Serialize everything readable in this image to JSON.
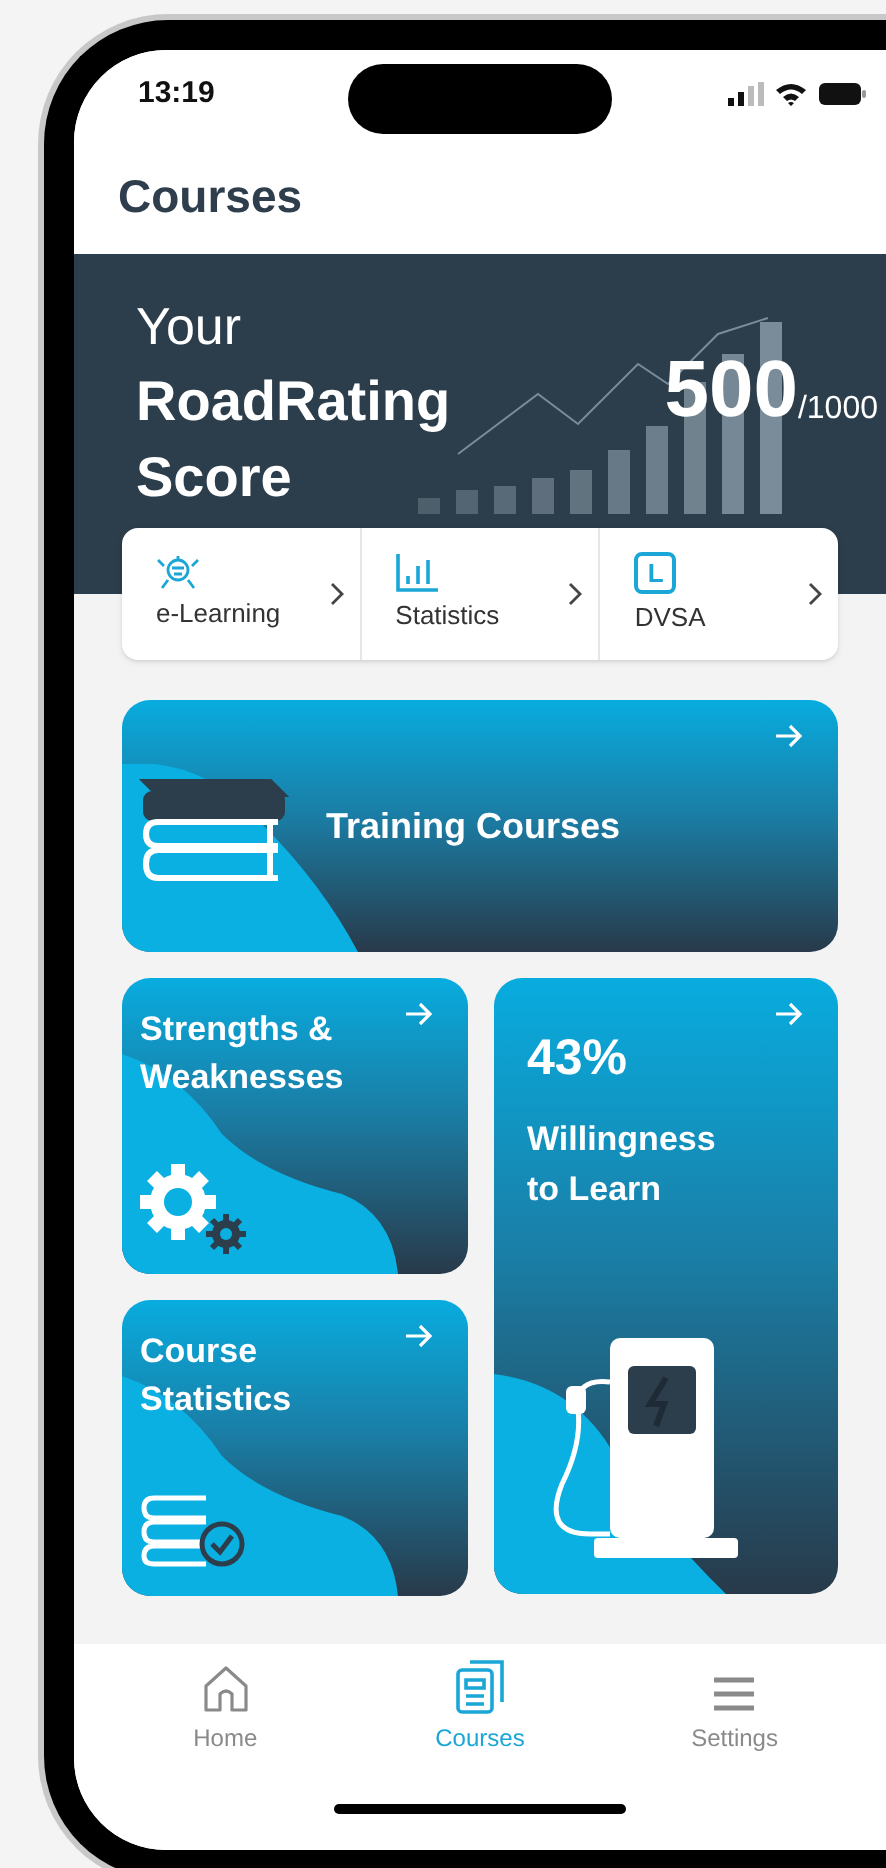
{
  "status_bar": {
    "time": "13:19"
  },
  "header": {
    "title": "Courses"
  },
  "score_banner": {
    "line_1": "Your",
    "line_2": "RoadRating",
    "line_3": "Score",
    "score": "500",
    "max": "/1000"
  },
  "quick_links": [
    {
      "label": "e-Learning"
    },
    {
      "label": "Statistics"
    },
    {
      "label": "DVSA",
      "badge": "L"
    }
  ],
  "cards": [
    {
      "kind": "wide",
      "title": "Training Courses"
    },
    {
      "kind": "small",
      "title": "Strengths & Weaknesses"
    },
    {
      "kind": "small",
      "title": "Course Statistics"
    },
    {
      "kind": "tall",
      "value": "43%",
      "title": "Willingness to Learn"
    }
  ],
  "nav": [
    {
      "label": "Home",
      "selected": false
    },
    {
      "label": "Courses",
      "selected": true
    },
    {
      "label": "Settings",
      "selected": false
    }
  ]
}
